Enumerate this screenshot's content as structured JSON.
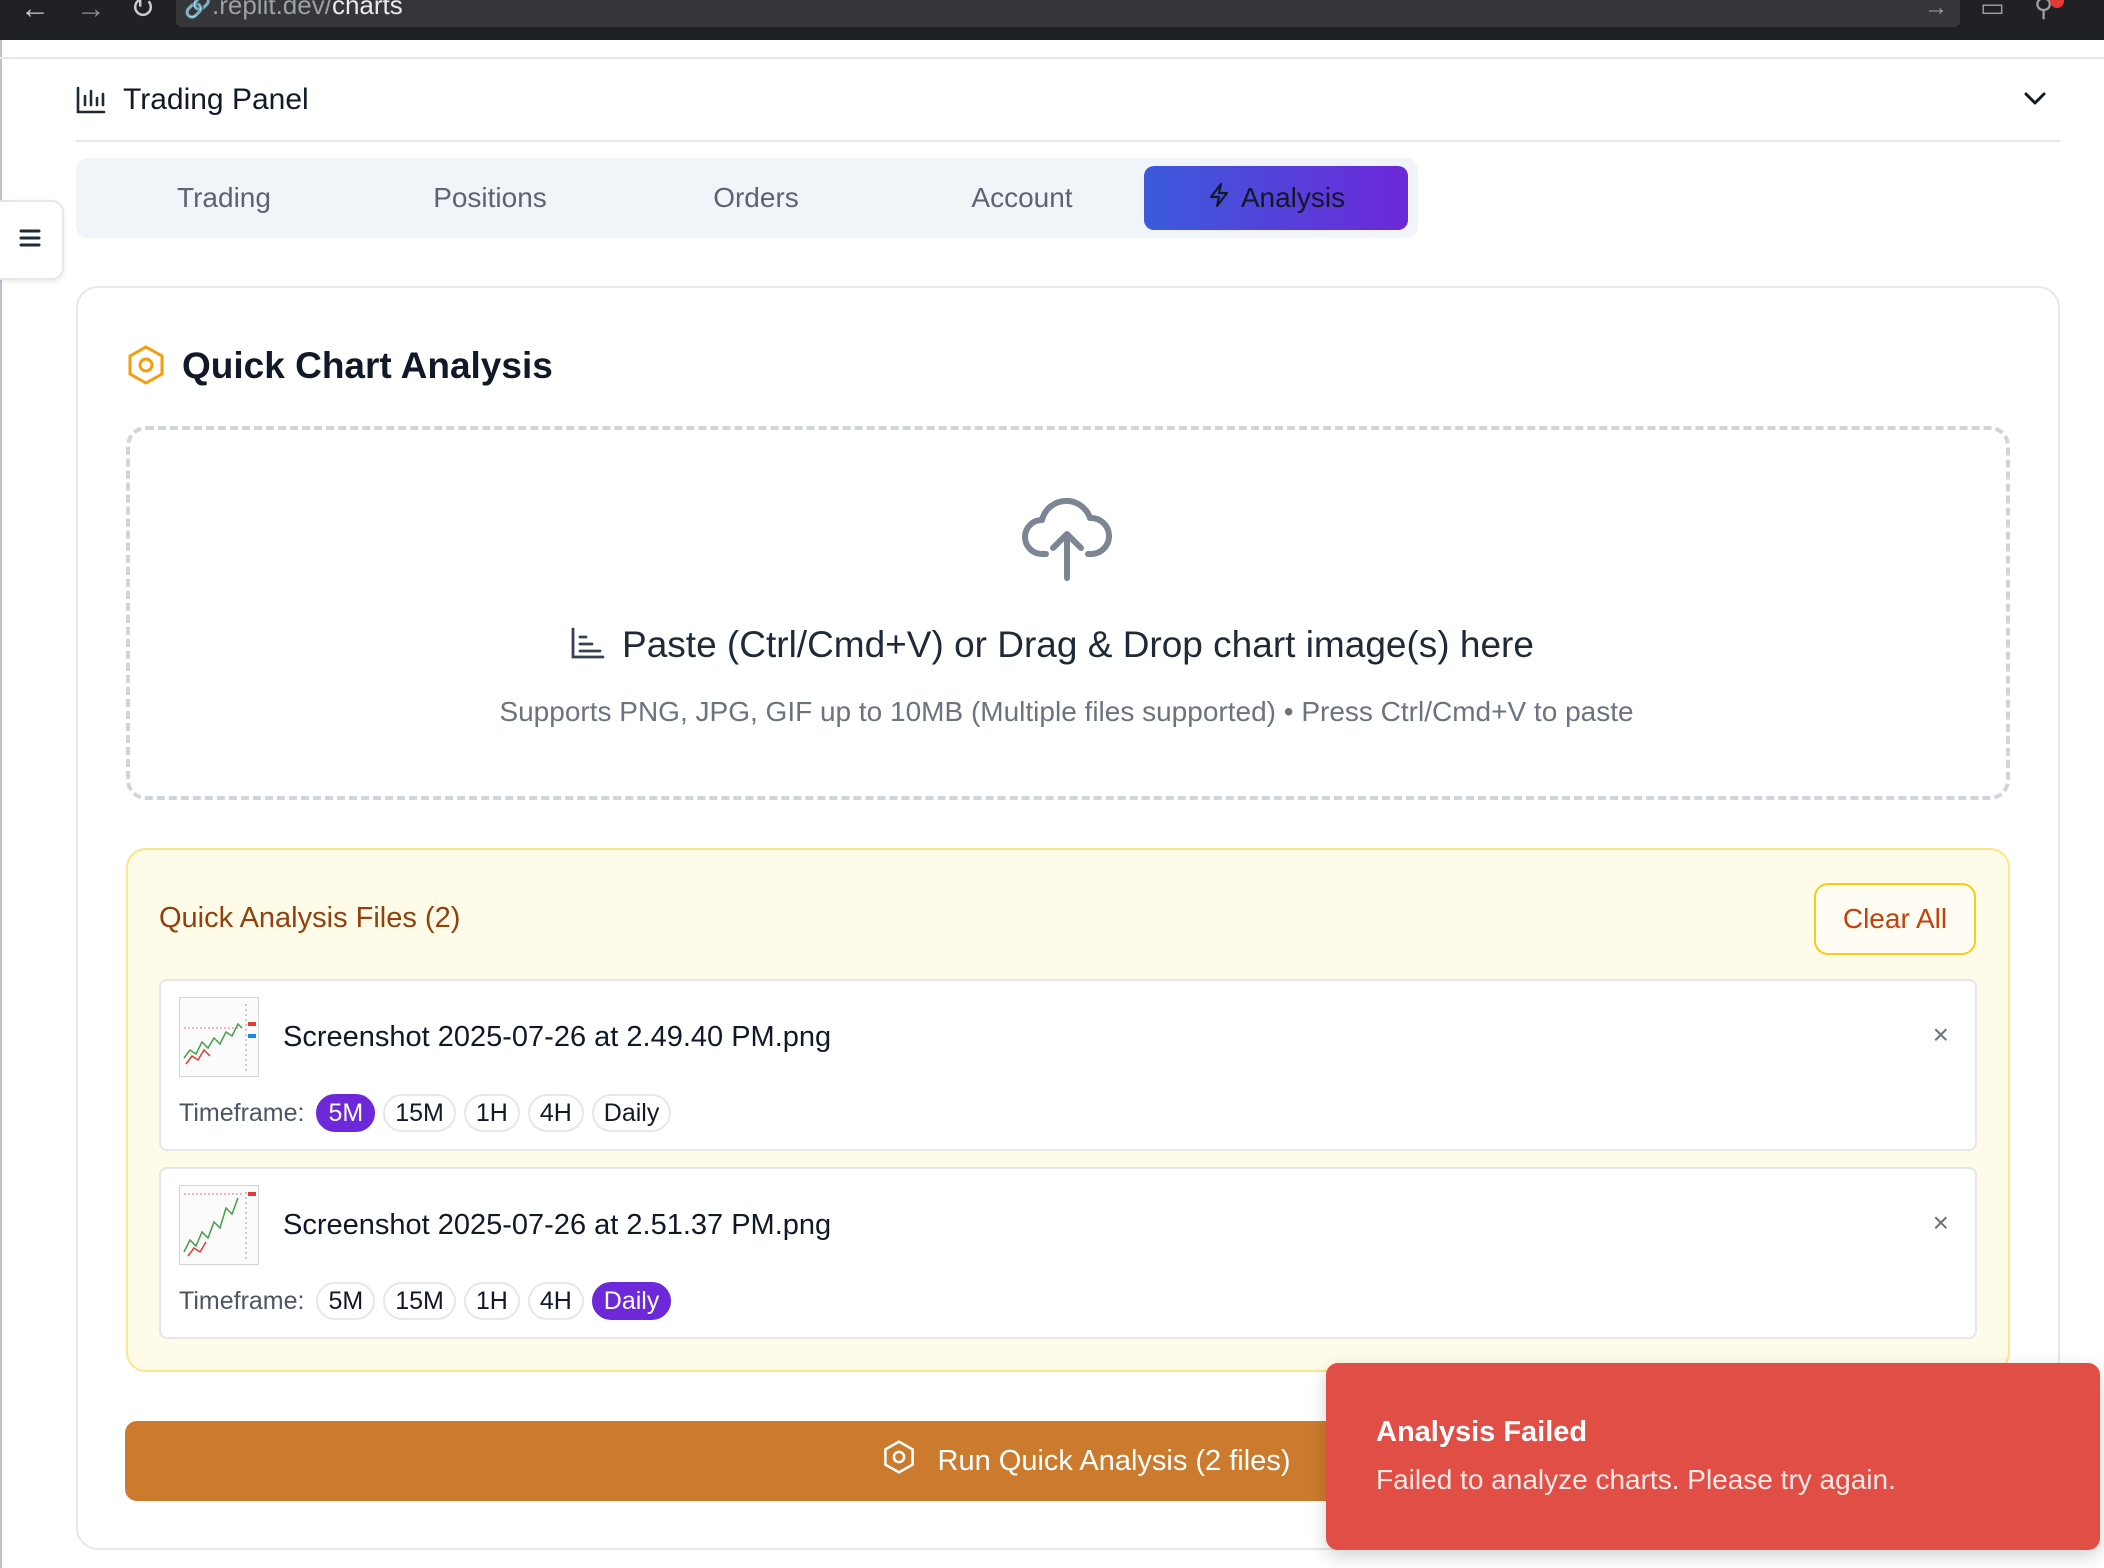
{
  "browser": {
    "url_prefix": ".replit.dev/",
    "url_path": "charts"
  },
  "panel": {
    "title": "Trading Panel",
    "icon": "bar-chart-icon",
    "collapse_icon": "chevron-down-icon"
  },
  "tabs": [
    {
      "label": "Trading",
      "active": false
    },
    {
      "label": "Positions",
      "active": false
    },
    {
      "label": "Orders",
      "active": false
    },
    {
      "label": "Account",
      "active": false
    },
    {
      "label": "Analysis",
      "active": true,
      "icon": "lightning-icon"
    }
  ],
  "card": {
    "title": "Quick Chart Analysis",
    "icon": "hexagon-gear-icon",
    "accent_color": "#f59e0b"
  },
  "dropzone": {
    "title": "Paste (Ctrl/Cmd+V) or Drag & Drop chart image(s) here",
    "subtitle": "Supports PNG, JPG, GIF up to 10MB (Multiple files supported) • Press Ctrl/Cmd+V to paste",
    "icon": "cloud-upload-icon"
  },
  "files": {
    "title": "Quick Analysis Files (2)",
    "clear_label": "Clear All",
    "timeframe_label": "Timeframe:",
    "items": [
      {
        "name": "Screenshot 2025-07-26 at 2.49.40 PM.png",
        "timeframes": [
          "5M",
          "15M",
          "1H",
          "4H",
          "Daily"
        ],
        "selected": "5M"
      },
      {
        "name": "Screenshot 2025-07-26 at 2.51.37 PM.png",
        "timeframes": [
          "5M",
          "15M",
          "1H",
          "4H",
          "Daily"
        ],
        "selected": "Daily"
      }
    ]
  },
  "run_button": {
    "label": "Run Quick Analysis (2 files)",
    "color": "#cc7a2d"
  },
  "toast": {
    "title": "Analysis Failed",
    "message": "Failed to analyze charts. Please try again.",
    "color": "#e04e45"
  },
  "colors": {
    "selected_chip": "#6d28d9",
    "tab_gradient_start": "#3b5bdb",
    "tab_gradient_end": "#6d28d9"
  }
}
